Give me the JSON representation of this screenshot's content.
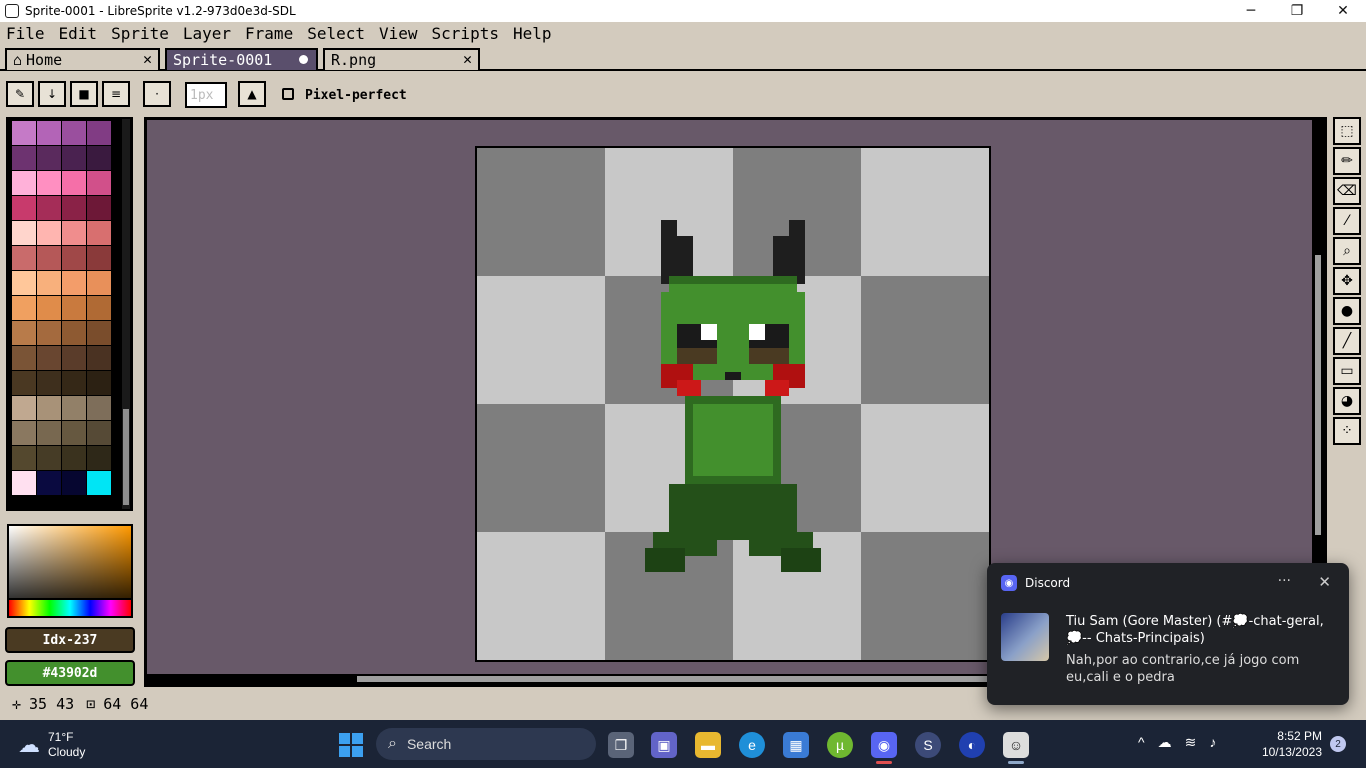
{
  "window": {
    "title": "Sprite-0001 - LibreSprite v1.2-973d0e3d-SDL",
    "minimize": "─",
    "maximize": "❐",
    "close": "✕"
  },
  "menu": [
    "File",
    "Edit",
    "Sprite",
    "Layer",
    "Frame",
    "Select",
    "View",
    "Scripts",
    "Help"
  ],
  "tabs": [
    {
      "label": "Home",
      "close": "✕",
      "icon": "home-icon"
    },
    {
      "label": "Sprite-0001",
      "active": true
    },
    {
      "label": "R.png",
      "close": "✕"
    }
  ],
  "toolbar": {
    "brush_size": "1px",
    "pixel_perfect_label": "Pixel-perfect"
  },
  "palette": [
    "#c57ac7",
    "#b364b7",
    "#9a4f9e",
    "#813c84",
    "#6d3370",
    "#5a2a5d",
    "#4a2250",
    "#3a1a3f",
    "#ffb1d9",
    "#ff8fc1",
    "#f56fa8",
    "#d1508a",
    "#c83a6c",
    "#a52d58",
    "#8a2247",
    "#6d1837",
    "#ffd5cc",
    "#ffb5b0",
    "#f08d8d",
    "#d86f6f",
    "#c96b6b",
    "#b55858",
    "#a04848",
    "#8a3a3a",
    "#ffc79a",
    "#f8b07c",
    "#f39d6a",
    "#e8905a",
    "#f0a060",
    "#e08c4a",
    "#c97a3e",
    "#b06a34",
    "#b87b4a",
    "#a46a3e",
    "#8e5a32",
    "#7a4d2c",
    "#7a5436",
    "#694630",
    "#5a3c2a",
    "#4a3222",
    "#4a3822",
    "#3e2f1d",
    "#352817",
    "#2c2113",
    "#c0a890",
    "#a89278",
    "#928068",
    "#7e6e5a",
    "#8a7860",
    "#786850",
    "#665840",
    "#564a36",
    "#54482e",
    "#463c26",
    "#3a321e",
    "#2e2818",
    "#ffe0f0",
    "#0a0a40",
    "#060630",
    "#00e5f5"
  ],
  "color_index": "Idx-237",
  "color_hex": "#43902d",
  "tools": [
    "select-tool",
    "pencil-tool",
    "eraser-tool",
    "eyedropper-tool",
    "zoom-tool",
    "move-tool",
    "fill-tool",
    "line-tool",
    "rectangle-tool",
    "ellipse-tool",
    "spray-tool"
  ],
  "status": {
    "cursor": "35 43",
    "size": "64 64"
  },
  "notification": {
    "app": "Discord",
    "sender": "Tiu Sam (Gore Master) (#💭-chat-geral, 💭-- Chats-Principais)",
    "message": "Nah,por ao contrario,ce já jogo com eu,cali e o pedra",
    "more": "···",
    "close": "✕"
  },
  "taskbar": {
    "weather_temp": "71°F",
    "weather_cond": "Cloudy",
    "search_label": "Search",
    "time": "8:52 PM",
    "date": "10/13/2023",
    "notif_count": "2"
  }
}
